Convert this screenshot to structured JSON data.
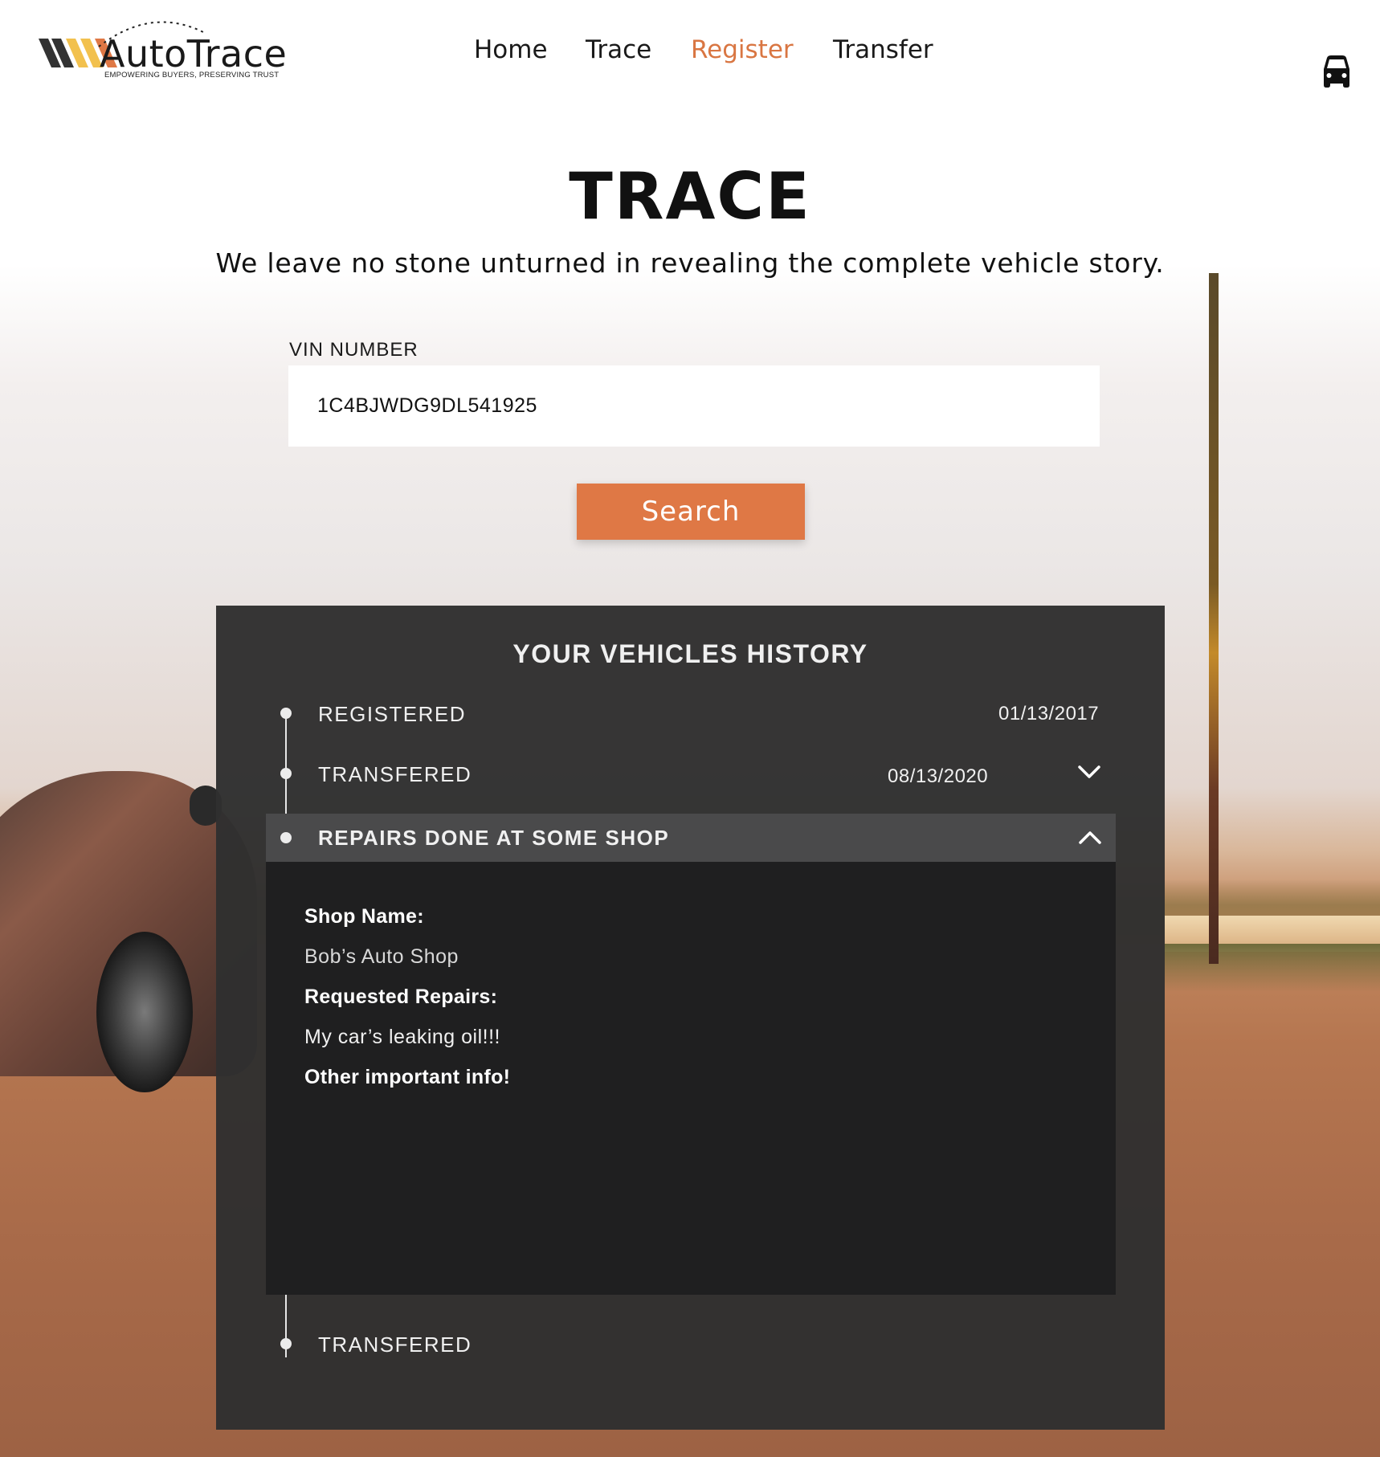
{
  "brand": {
    "name": "AutoTrace",
    "tagline": "EMPOWERING BUYERS, PRESERVING TRUST",
    "colors": {
      "accent": "#df7845",
      "stripe_dark": "#333333",
      "stripe_yellow": "#f2c14e",
      "stripe_orange": "#df7845"
    }
  },
  "nav": {
    "items": [
      {
        "label": "Home",
        "active": false
      },
      {
        "label": "Trace",
        "active": false
      },
      {
        "label": "Register",
        "active": true
      },
      {
        "label": "Transfer",
        "active": false
      }
    ],
    "right_icon": "car-icon"
  },
  "hero": {
    "title": "TRACE",
    "tagline": "We leave no stone unturned in revealing the complete vehicle story."
  },
  "vin": {
    "label": "VIN NUMBER",
    "value": "1C4BJWDG9DL541925",
    "button_label": "Search"
  },
  "history": {
    "title": "YOUR VEHICLES HISTORY",
    "events": [
      {
        "label": "REGISTERED",
        "date": "01/13/2017",
        "expandable": false
      },
      {
        "label": "TRANSFERED",
        "date": "08/13/2020",
        "expandable": true,
        "expanded": false,
        "icon": "chevron-down-icon"
      },
      {
        "label": "REPAIRS DONE AT SOME SHOP",
        "date": "",
        "expandable": true,
        "expanded": true,
        "icon": "chevron-up-icon",
        "details": {
          "shop_name_label": "Shop Name:",
          "shop_name_value": "Bob’s Auto Shop",
          "requested_label": "Requested Repairs:",
          "requested_value": "My car’s leaking oil!!!",
          "other_label": "Other important info!"
        }
      },
      {
        "label": "TRANSFERED",
        "date": "",
        "expandable": false
      }
    ]
  }
}
